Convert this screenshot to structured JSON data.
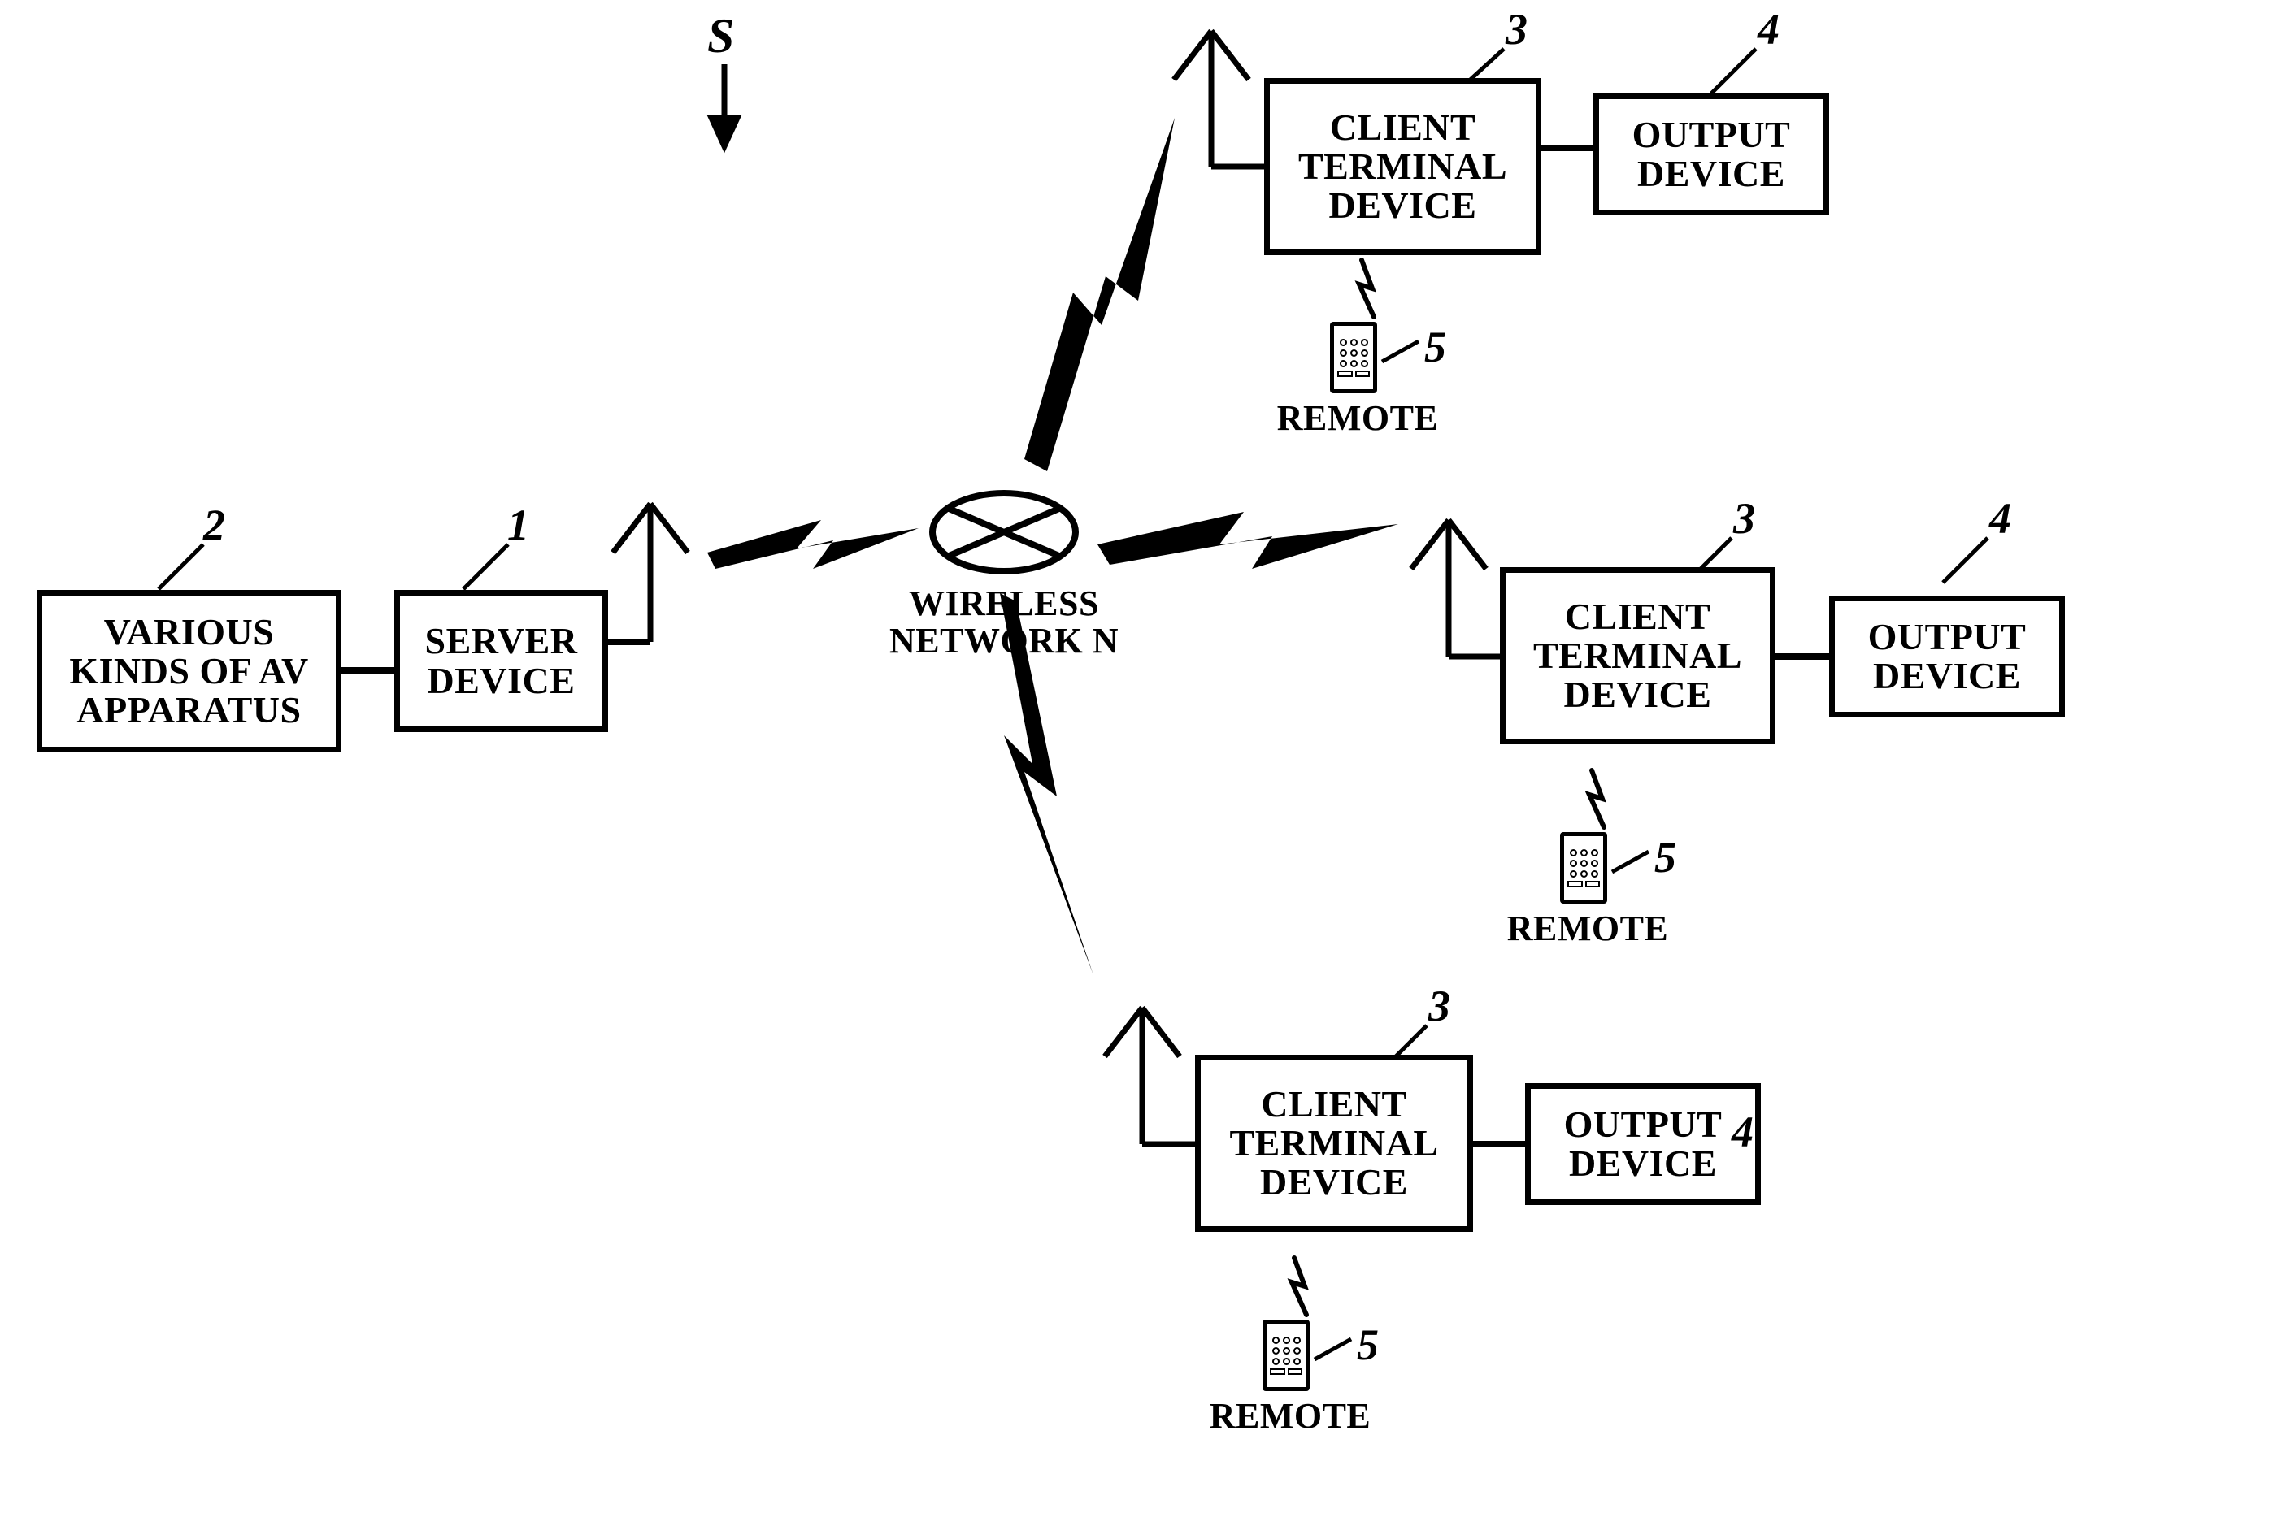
{
  "diagram": {
    "system_ref": "S",
    "network_label": "WIRELESS\nNETWORK N",
    "server": {
      "ref": "1",
      "label": "SERVER\nDEVICE"
    },
    "av": {
      "ref": "2",
      "label": "VARIOUS\nKINDS OF AV\nAPPARATUS"
    },
    "client": {
      "ref": "3",
      "label": "CLIENT\nTERMINAL\nDEVICE"
    },
    "output": {
      "ref": "4",
      "label": "OUTPUT\nDEVICE"
    },
    "remote": {
      "ref": "5",
      "label": "REMOTE"
    }
  }
}
